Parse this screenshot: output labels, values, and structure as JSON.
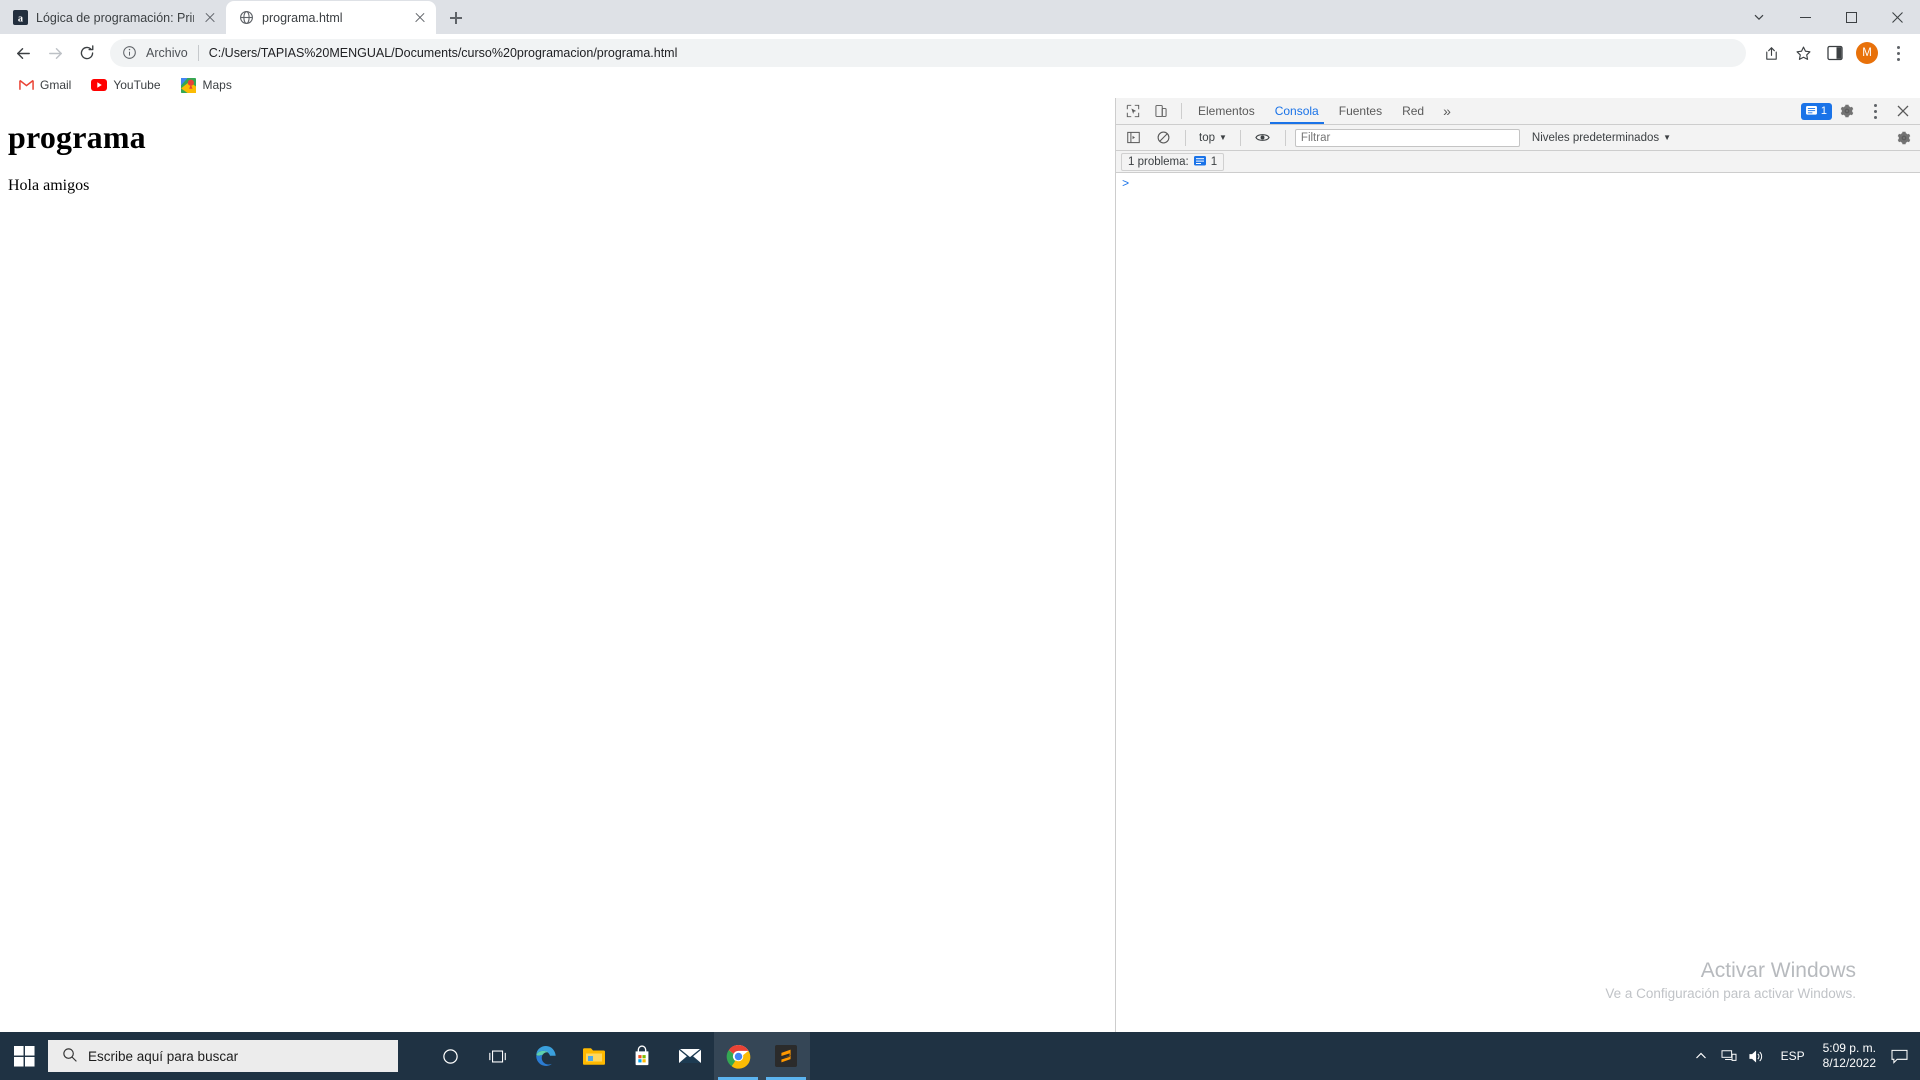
{
  "browser": {
    "tabs": [
      {
        "title": "Lógica de programación: Primero",
        "favicon": "amazon-icon",
        "active": false
      },
      {
        "title": "programa.html",
        "favicon": "globe-icon",
        "active": true
      }
    ],
    "new_tab_label": "+",
    "window_controls": {
      "minimize": "minimize-icon",
      "maximize": "maximize-icon",
      "close": "close-icon",
      "dropdown": "tab-search-icon"
    },
    "omnibox": {
      "scheme_label": "Archivo",
      "url": "C:/Users/TAPIAS%20MENGUAL/Documents/curso%20programacion/programa.html",
      "info_icon": "info-circle-icon"
    },
    "nav": {
      "back": "back-arrow-icon",
      "forward": "forward-arrow-icon",
      "reload": "reload-icon"
    },
    "toolbar_icons": {
      "share": "share-icon",
      "bookmark": "star-icon",
      "sidepanel": "side-panel-icon",
      "profile_initial": "M",
      "menu": "kebab-menu-icon"
    },
    "bookmarks": [
      {
        "label": "Gmail",
        "icon": "gmail-icon"
      },
      {
        "label": "YouTube",
        "icon": "youtube-icon"
      },
      {
        "label": "Maps",
        "icon": "maps-icon"
      }
    ]
  },
  "page": {
    "heading": "programa",
    "paragraph": "Hola amigos"
  },
  "devtools": {
    "left_icons": {
      "inspect": "inspect-element-icon",
      "device": "device-toolbar-icon"
    },
    "tabs": [
      {
        "label": "Elementos",
        "selected": false
      },
      {
        "label": "Consola",
        "selected": true
      },
      {
        "label": "Fuentes",
        "selected": false
      },
      {
        "label": "Red",
        "selected": false
      }
    ],
    "more_tabs": "»",
    "issues_count": "1",
    "issues_icon": "issue-message-icon",
    "settings_icon": "gear-icon",
    "menu_icon": "kebab-menu-icon",
    "close_icon": "close-icon",
    "console_toolbar": {
      "sidebar_icon": "console-sidebar-icon",
      "clear_icon": "clear-console-icon",
      "context": "top",
      "context_caret": "▼",
      "eye_icon": "live-expression-icon",
      "filter_placeholder": "Filtrar",
      "filter_value": "",
      "levels_label": "Niveles predeterminados",
      "levels_caret": "▼",
      "settings_icon": "gear-icon"
    },
    "problems": {
      "label": "1 problema:",
      "count": "1",
      "badge_icon": "issue-message-icon"
    },
    "prompt_caret": ">"
  },
  "watermark": {
    "title": "Activar Windows",
    "subtitle": "Ve a Configuración para activar Windows."
  },
  "taskbar": {
    "start_icon": "windows-start-icon",
    "search_placeholder": "Escribe aquí para buscar",
    "search_icon": "search-icon",
    "apps": [
      {
        "name": "cortana-icon",
        "active": false
      },
      {
        "name": "task-view-icon",
        "active": false
      },
      {
        "name": "edge-icon",
        "active": false
      },
      {
        "name": "file-explorer-icon",
        "active": false
      },
      {
        "name": "microsoft-store-icon",
        "active": false
      },
      {
        "name": "mail-icon",
        "active": false
      },
      {
        "name": "chrome-icon",
        "active": true
      },
      {
        "name": "sublime-text-icon",
        "active": true
      }
    ],
    "tray": {
      "chevron": "show-hidden-icons-icon",
      "network": "network-icon",
      "volume": "volume-icon",
      "language": "ESP",
      "time": "5:09 p. m.",
      "date": "8/12/2022",
      "action_center": "action-center-icon"
    }
  },
  "colors": {
    "accent_blue": "#1a73e8",
    "tabstrip_bg": "#dee1e6",
    "taskbar_bg": "#1f3243",
    "profile_orange": "#e8710a"
  }
}
